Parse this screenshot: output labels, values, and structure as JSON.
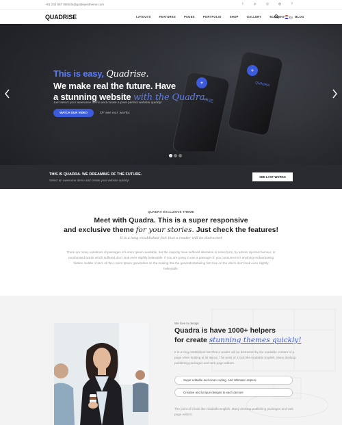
{
  "topbar": {
    "phone": "+01 234 567 890",
    "email": "info@goldeyestheme.com",
    "socials": [
      "twitter-icon",
      "pinterest-icon",
      "instagram-icon",
      "dribbble-icon",
      "facebook-icon"
    ]
  },
  "nav": {
    "logo": "QUADRISE",
    "items": [
      "LAYOUTS",
      "FEATURES",
      "PAGES",
      "PORTFOLIO",
      "SHOP",
      "GALLERY",
      "ELEMENTS",
      "BLOG"
    ],
    "language": "En"
  },
  "hero": {
    "line1_plain": "This is easy,",
    "line1_script": "Quadrise.",
    "line2": "We make real the future. Have",
    "line3_plain": "a stunning website",
    "line3_script": "with the Quadra.",
    "subtitle": "Just select your awesome demo and create a pixel perfect website quickly!",
    "watch_button": "WATCH OUR VIDEO",
    "see_works": "Or see our works",
    "phone_label_left": "RISE",
    "phone_label_right": "QUADRA",
    "slides": 3,
    "active_slide": 1
  },
  "strip": {
    "title": "THIS IS QUADRA. WE DREAMING OF THE FUTURE.",
    "subtitle": "Select an awesome demo and create your website quickly!",
    "button": "SEE LAST WORKS"
  },
  "meet": {
    "kicker": "QUADRA EXCLUSIVE THEME",
    "title_line1": "Meet with Quadra. This is a super responsive",
    "title_line2_a": "and exclusive theme",
    "title_line2_script": "for your stories.",
    "title_line2_b": "Just check the features!",
    "italic": "It is a long established fact that a reader will be distracted",
    "body": "There are many variations of passages of Lorem Ipsum available, but the majority have suffered alteration in some form, by adonis injected humour, or randomised words which suffered don't look even slightly believable. If you are going to use a passage of, you consume isn't anything embarrassing hidden middle of text. All the Lorem Ipsum generators on the making this the generatorsetaliing first true on the which don't look even slightly believable."
  },
  "helpers": {
    "kicker": "We love to design",
    "title_line1": "Quadra is have 1000+ helpers",
    "title_line2_plain": "for create",
    "title_line2_script": "stunning themes quickly!",
    "body": "It is a long established fact that a reader will be distracted by the readable content of a page when looking at its layout. The point of it look like readable English. Many desktop publishing packages and web page editors.",
    "pill1": "Super editable and clean coding. And Ultimate Helpers.",
    "pill2": "Creative and Unique designs to each demos!",
    "body2": "The point of it look like readable English. Many desktop publishing packages and web page editors."
  },
  "colors": {
    "accent": "#3b5bdb",
    "hero_bg": "#24262b",
    "strip_bg": "#2a2b30",
    "section_bg": "#f3f3f4"
  }
}
